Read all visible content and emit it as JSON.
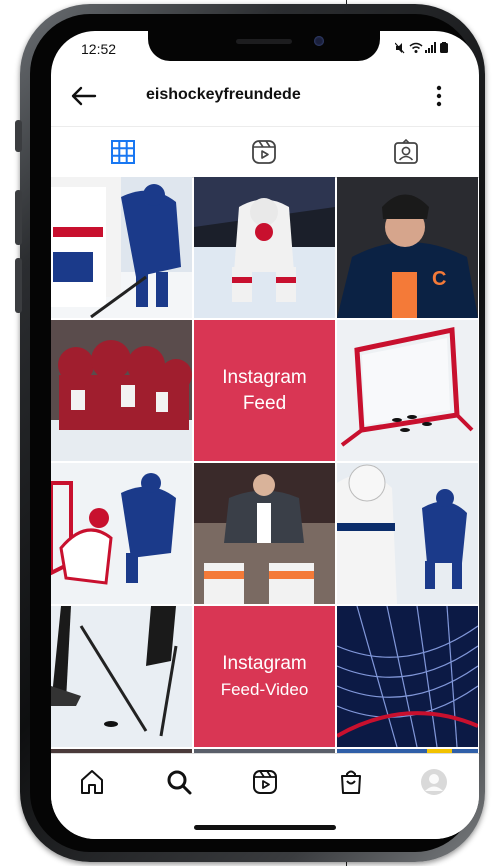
{
  "status": {
    "time": "12:52"
  },
  "header": {
    "username": "eishockeyfreundede"
  },
  "grid": {
    "promo1": {
      "line1": "Instagram",
      "line2": "Feed"
    },
    "promo2": {
      "line1": "Instagram",
      "line2": "Feed-Video"
    }
  },
  "colors": {
    "promo": "#d93654",
    "accent": "#1877f2"
  }
}
